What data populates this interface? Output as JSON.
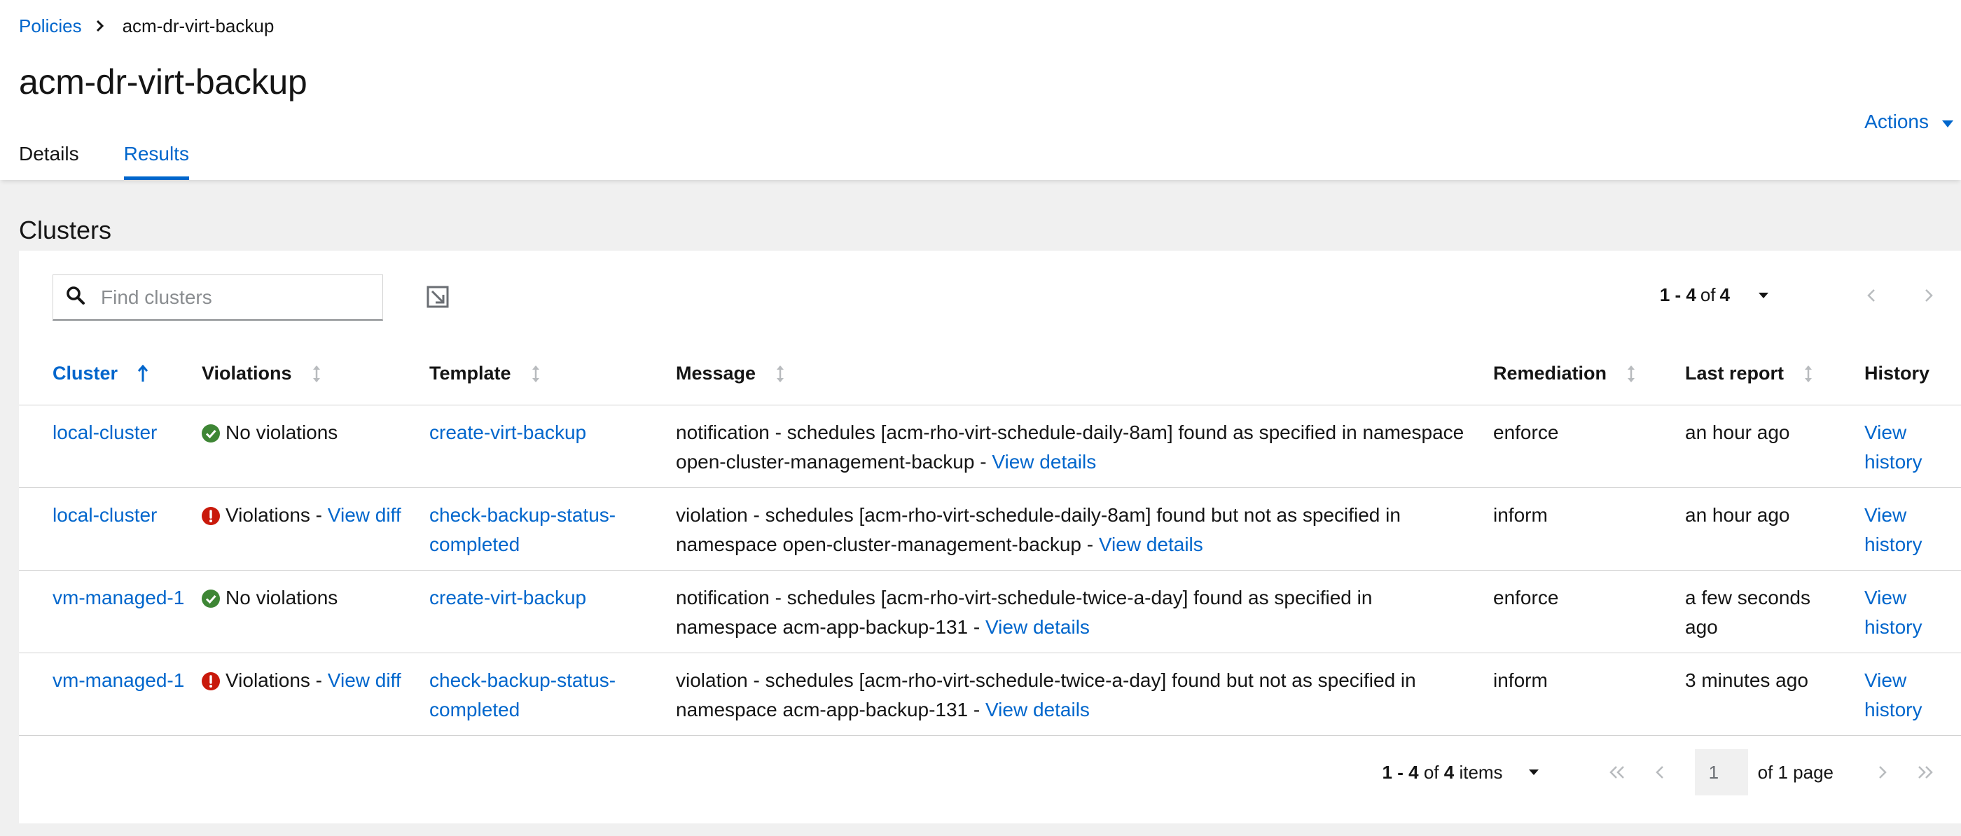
{
  "breadcrumb": {
    "parent": "Policies",
    "current": "acm-dr-virt-backup"
  },
  "page": {
    "title": "acm-dr-virt-backup",
    "actions_label": "Actions"
  },
  "tabs": [
    {
      "label": "Details"
    },
    {
      "label": "Results"
    }
  ],
  "section": {
    "title": "Clusters"
  },
  "search": {
    "placeholder": "Find clusters"
  },
  "top_pagination": {
    "range": "1 - 4",
    "of_text": "of",
    "total": "4"
  },
  "columns": {
    "cluster": "Cluster",
    "violations": "Violations",
    "template": "Template",
    "message": "Message",
    "remediation": "Remediation",
    "last_report": "Last report",
    "history": "History"
  },
  "rows": [
    {
      "cluster": "local-cluster",
      "status": "ok",
      "violations_text": "No violations",
      "view_diff": "",
      "template": "create-virt-backup",
      "message": "notification - schedules [acm-rho-virt-schedule-daily-8am] found as specified in namespace open-cluster-management-backup - ",
      "message_link": "View details",
      "remediation": "enforce",
      "last_report": "an hour ago",
      "history": "View history"
    },
    {
      "cluster": "local-cluster",
      "status": "violation",
      "violations_text": "Violations - ",
      "view_diff": "View diff",
      "template": "check-backup-status-completed",
      "message": "violation - schedules [acm-rho-virt-schedule-daily-8am] found but not as specified in namespace open-cluster-management-backup - ",
      "message_link": "View details",
      "remediation": "inform",
      "last_report": "an hour ago",
      "history": "View history"
    },
    {
      "cluster": "vm-managed-1",
      "status": "ok",
      "violations_text": "No violations",
      "view_diff": "",
      "template": "create-virt-backup",
      "message": "notification - schedules [acm-rho-virt-schedule-twice-a-day] found as specified in namespace acm-app-backup-131 - ",
      "message_link": "View details",
      "remediation": "enforce",
      "last_report": "a few seconds ago",
      "history": "View history"
    },
    {
      "cluster": "vm-managed-1",
      "status": "violation",
      "violations_text": "Violations - ",
      "view_diff": "View diff",
      "template": "check-backup-status-completed",
      "message": "violation - schedules [acm-rho-virt-schedule-twice-a-day] found but not as specified in namespace acm-app-backup-131 - ",
      "message_link": "View details",
      "remediation": "inform",
      "last_report": "3 minutes ago",
      "history": "View history"
    }
  ],
  "bottom_pagination": {
    "range": "1 - 4",
    "of_text": "of",
    "total": "4",
    "items_label": "items",
    "page_value": "1",
    "page_of_text": "of 1 page"
  },
  "colors": {
    "link": "#0066cc",
    "success": "#3e8635",
    "danger": "#c9190b",
    "page_bg": "#f0f0f0"
  }
}
